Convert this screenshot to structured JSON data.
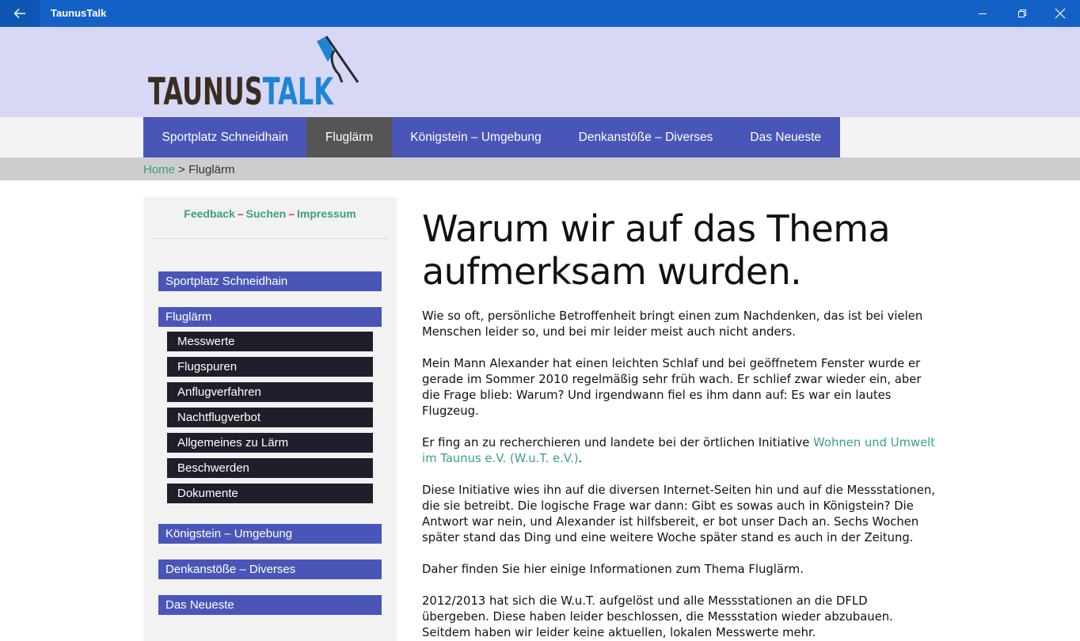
{
  "window": {
    "title": "TaunusTalk"
  },
  "logo": {
    "text": "TAUNUSTALK"
  },
  "nav": {
    "items": [
      "Sportplatz Schneidhain",
      "Fluglärm",
      "Königstein – Umgebung",
      "Denkanstöße – Diverses",
      "Das Neueste"
    ]
  },
  "breadcrumb": {
    "home": "Home",
    "separator": " > ",
    "current": "Fluglärm"
  },
  "sidebar": {
    "feedback": "Feedback",
    "suchen": "Suchen",
    "impressum": "Impressum",
    "dash": "–",
    "sportplatz": "Sportplatz Schneidhain",
    "fluglaerm": "Fluglärm",
    "sub": [
      "Messwerte",
      "Flugspuren",
      "Anflugverfahren",
      "Nachtflugverbot",
      "Allgemeines zu Lärm",
      "Beschwerden",
      "Dokumente"
    ],
    "koenigstein": "Königstein – Umgebung",
    "denkanstoesse": "Denkanstöße – Diverses",
    "neueste": "Das Neueste"
  },
  "article": {
    "title_line1": "Warum wir auf das Thema",
    "title_line2": "aufmerksam wurden.",
    "p1": "Wie so oft, persönliche Betroffenheit bringt einen zum Nachdenken, das ist bei vielen Menschen leider so, und bei mir leider meist auch nicht anders.",
    "p2": "Mein Mann Alexander hat einen leichten Schlaf und bei geöffnetem Fenster wurde er gerade im Sommer 2010 regelmäßig sehr früh wach. Er schlief zwar wieder ein, aber die Frage blieb: Warum? Und irgendwann fiel es ihm dann auf: Es war ein lautes Flugzeug.",
    "p3_pre": "Er fing an zu recherchieren und landete bei der örtlichen Initiative ",
    "p3_link": "Wohnen und Umwelt im Taunus e.V. (W.u.T. e.V.)",
    "p3_post": ".",
    "p4": "Diese Initiative wies ihn auf die diversen Internet-Seiten hin und auf die Messstationen, die sie betreibt. Die logische Frage war dann: Gibt es sowas auch in Königstein? Die Antwort war nein, und Alexander ist hilfsbereit, er bot unser Dach an. Sechs Wochen später stand das Ding und eine weitere Woche später stand es auch in der Zeitung.",
    "p5": "Daher finden Sie hier einige Informationen zum Thema Fluglärm.",
    "p6": "2012/2013 hat sich die W.u.T. aufgelöst und alle Messstationen an die DFLD übergeben. Diese haben leider beschlossen, die Messstation wieder abzubauen. Seitdem haben wir leider keine aktuellen, lokalen Messwerte mehr."
  }
}
